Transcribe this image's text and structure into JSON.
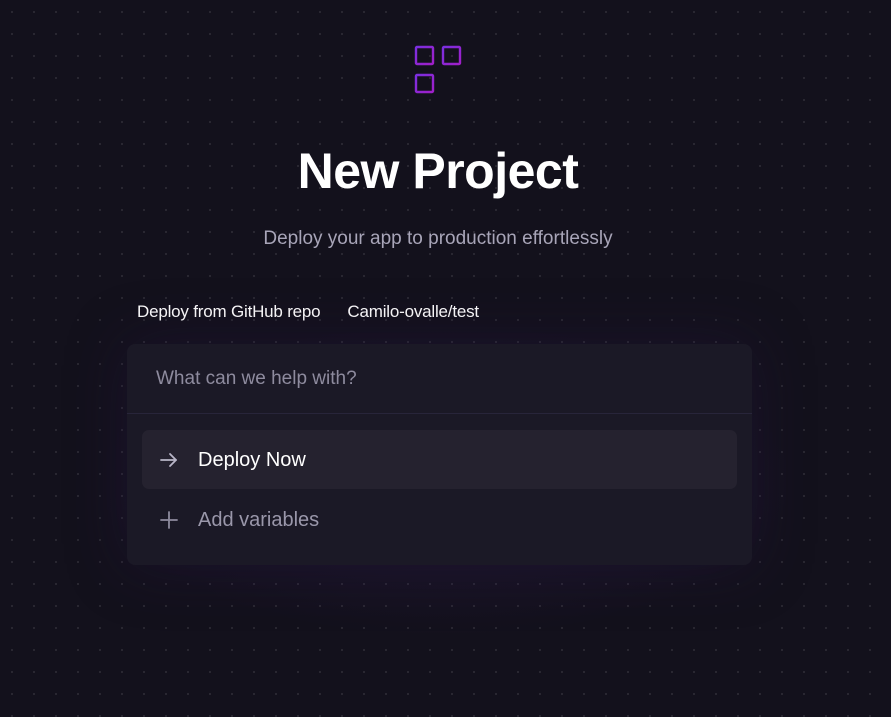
{
  "header": {
    "logo_icon": "grid-plus-icon",
    "title": "New Project",
    "subtitle": "Deploy your app to production effortlessly"
  },
  "breadcrumb": {
    "items": [
      {
        "label": "Deploy from GitHub repo"
      },
      {
        "label": "Camilo-ovalle/test"
      }
    ]
  },
  "prompt": {
    "placeholder": "What can we help with?",
    "value": ""
  },
  "options": [
    {
      "label": "Deploy Now",
      "icon": "arrow-right-icon",
      "highlighted": true
    },
    {
      "label": "Add variables",
      "icon": "plus-icon",
      "highlighted": false
    }
  ],
  "colors": {
    "background": "#13111c",
    "accent": "#8a1fd6",
    "card": "#1b1926",
    "highlight": "#25222f"
  }
}
